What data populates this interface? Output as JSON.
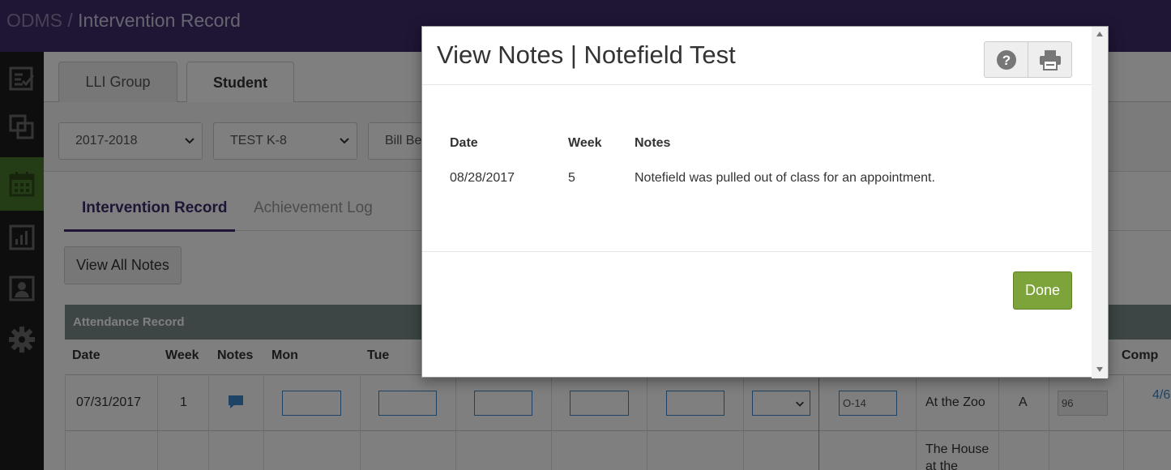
{
  "topbar": {
    "app": "ODMS",
    "separator": " / ",
    "page": "Intervention Record"
  },
  "nav": {
    "icons": [
      "checklist-icon",
      "copy-icon",
      "calendar-icon",
      "bar-chart-icon",
      "profile-icon",
      "gear-icon"
    ],
    "active_index": 2
  },
  "tabs": [
    {
      "label": "LLI Group"
    },
    {
      "label": "Student"
    }
  ],
  "filters": [
    {
      "value": "2017-2018"
    },
    {
      "value": "TEST K-8"
    },
    {
      "value": "Bill Be"
    }
  ],
  "subtabs": [
    {
      "label": "Intervention Record"
    },
    {
      "label": "Achievement Log"
    }
  ],
  "view_all_notes_label": "View All Notes",
  "attendance": {
    "title": "Attendance Record",
    "columns": [
      "Date",
      "Week",
      "Notes",
      "Mon",
      "Tue",
      "Comp"
    ],
    "row1": {
      "date": "07/31/2017",
      "week": "1",
      "level": "O-14",
      "book": "At the Zoo",
      "grade": "A",
      "score": "96",
      "comp": "4/6"
    },
    "row2": {
      "book": "The House at the"
    }
  },
  "modal": {
    "title": "View Notes | Notefield Test",
    "columns": [
      "Date",
      "Week",
      "Notes"
    ],
    "rows": [
      {
        "date": "08/28/2017",
        "week": "5",
        "note": "Notefield was pulled out of class for an appointment."
      }
    ],
    "done_label": "Done"
  },
  "colors": {
    "topbar": "#3f2b6b",
    "nav_active": "#4a7a2c",
    "done": "#7da43a"
  }
}
